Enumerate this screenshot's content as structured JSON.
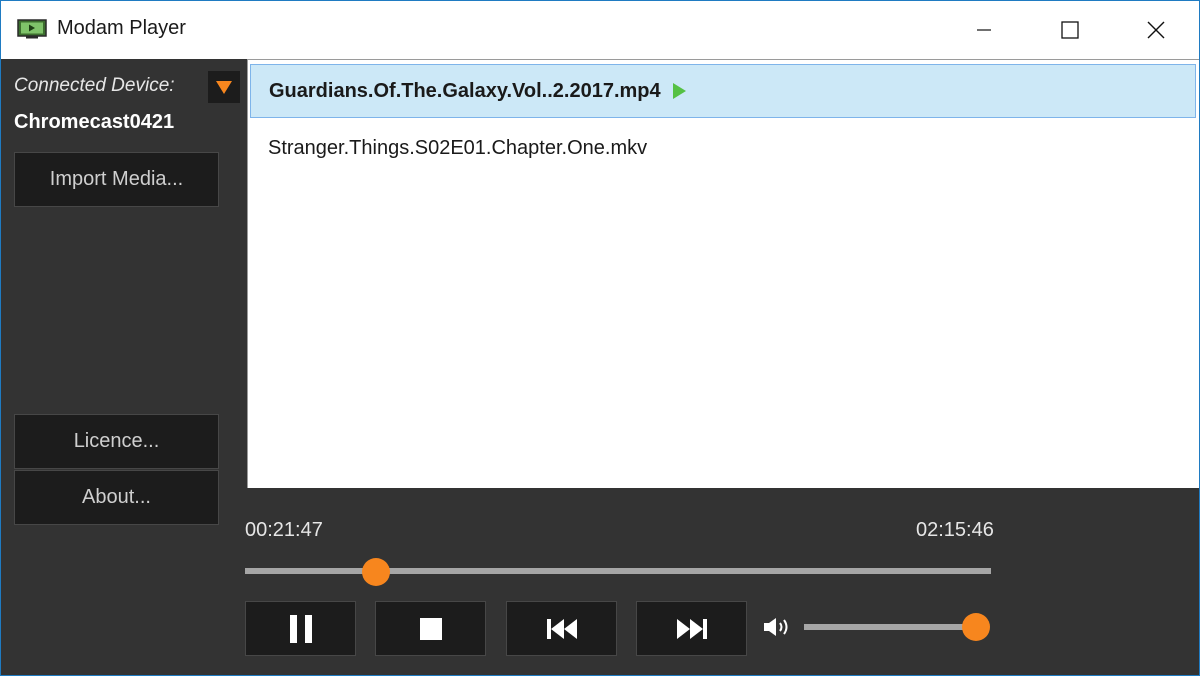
{
  "window": {
    "title": "Modam Player",
    "accent_color": "#f7861e",
    "icons": {
      "app": "monitor-play-icon",
      "minimize": "minimize-icon",
      "maximize": "maximize-icon",
      "close": "close-icon"
    }
  },
  "sidebar": {
    "device_label": "Connected Device:",
    "device_name": "Chromecast0421",
    "dropdown_icon": "triangle-down-icon",
    "import_label": "Import Media...",
    "licence_label": "Licence...",
    "about_label": "About..."
  },
  "playlist": {
    "items": [
      {
        "title": "Guardians.Of.The.Galaxy.Vol..2.2017.mp4",
        "selected": true,
        "playing": true
      },
      {
        "title": "Stranger.Things.S02E01.Chapter.One.mkv",
        "selected": false,
        "playing": false
      }
    ],
    "selected_bg": "#cce8f7",
    "playing_indicator_color": "#55c144"
  },
  "playback": {
    "elapsed": "00:21:47",
    "total": "02:15:46",
    "progress_fraction": 0.175,
    "volume_fraction": 1.0
  },
  "transport": {
    "pause_icon": "pause-icon",
    "stop_icon": "stop-icon",
    "previous_icon": "skip-previous-icon",
    "next_icon": "skip-next-icon",
    "volume_icon": "volume-icon"
  }
}
